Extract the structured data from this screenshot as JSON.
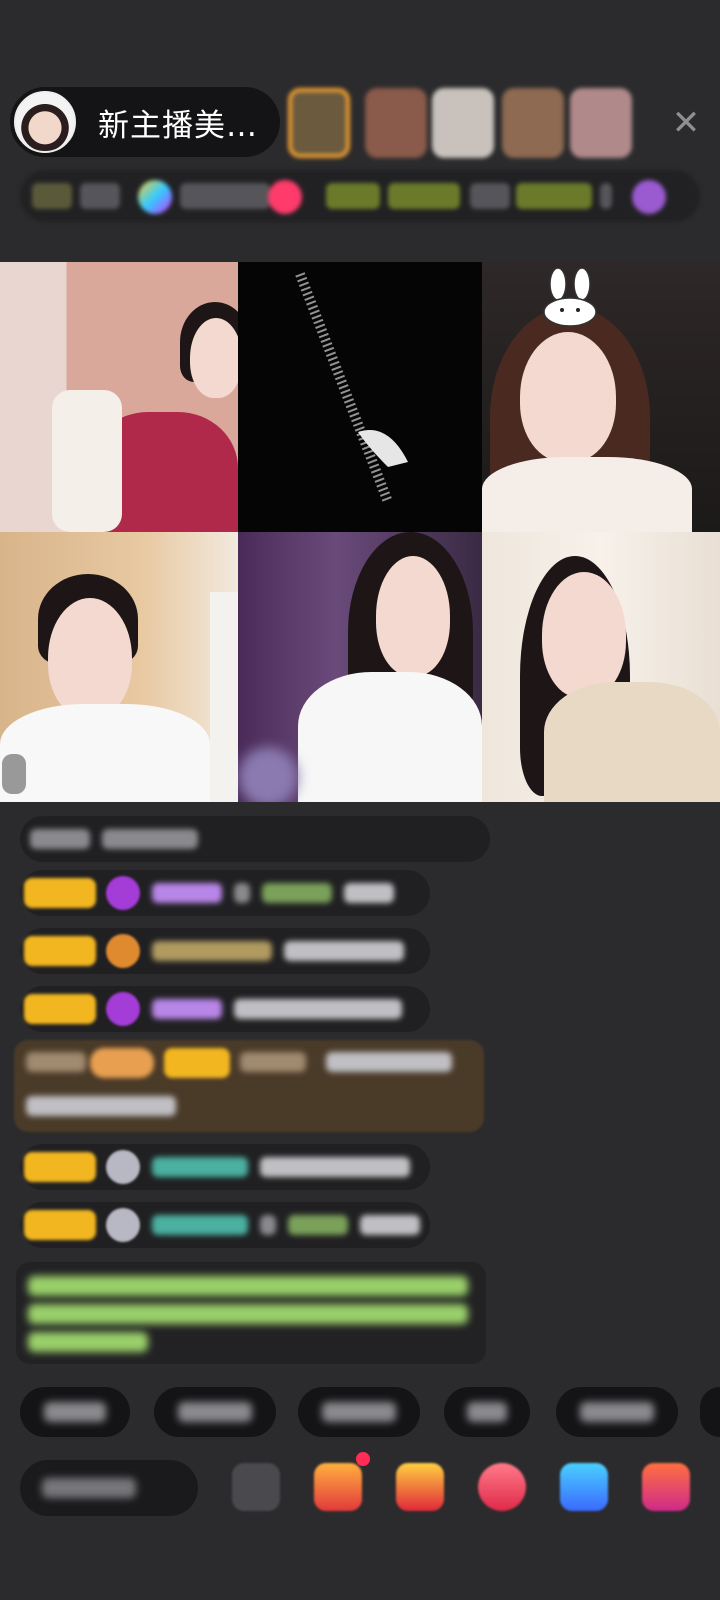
{
  "host": {
    "name": "新主播美…"
  },
  "viewers": [
    {
      "color": "#6b5a3e",
      "ring": "#f0a030"
    },
    {
      "color": "#8a5a4a",
      "ring": "#c9a06a"
    },
    {
      "color": "#c9c2bc",
      "ring": "#3b3b3e"
    },
    {
      "color": "#8e6a52",
      "ring": "#c9a06a"
    },
    {
      "color": "#b08a8a",
      "ring": "#3b3b3e"
    }
  ],
  "close_icon": "close-icon",
  "chat_colors": {
    "badge": "#f2b620",
    "gift_bg": "#4a3a28",
    "system_text": "#9ad06a",
    "teal_name": "#4ab0a0"
  },
  "bottom_icons": [
    "dice-icon",
    "red-gift-icon",
    "gold-gift-icon",
    "heart-gift-icon",
    "blue-gift-icon",
    "box-gift-icon"
  ]
}
